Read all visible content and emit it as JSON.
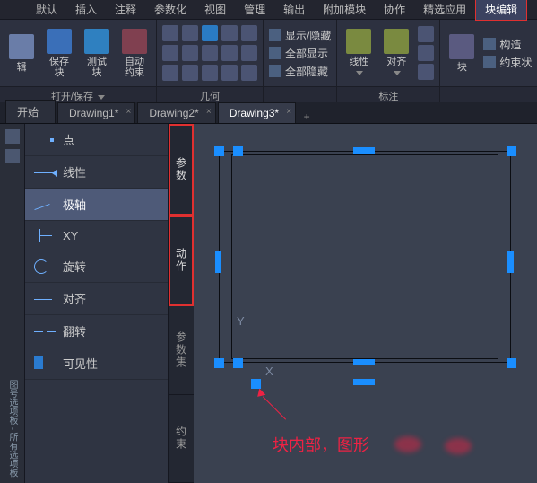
{
  "menu": {
    "items": [
      "默认",
      "插入",
      "注释",
      "参数化",
      "视图",
      "管理",
      "输出",
      "附加模块",
      "协作",
      "精选应用",
      "块编辑"
    ],
    "active_index": 10
  },
  "ribbon": {
    "panel_open": {
      "label": "打开/保存",
      "btn_edit": "辑",
      "btn_save": "保存\n块",
      "btn_test": "测试\n块",
      "btn_auto": "自动\n约束"
    },
    "panel_geom": {
      "label": "几何"
    },
    "panel_show": {
      "label": "",
      "btn_show": "显示/隐藏",
      "btn_all": "全部显示",
      "btn_hideall": "全部隐藏"
    },
    "panel_dim": {
      "label": "标注",
      "btn_linear": "线性",
      "btn_align": "对齐"
    },
    "panel_cons": {
      "label": "",
      "btn_block": "块",
      "btn_cons": "构造",
      "btn_status": "约束状"
    }
  },
  "tabs": [
    {
      "label": "开始",
      "active": false,
      "closable": false
    },
    {
      "label": "Drawing1*",
      "active": false,
      "closable": true
    },
    {
      "label": "Drawing2*",
      "active": false,
      "closable": true
    },
    {
      "label": "Drawing3*",
      "active": true,
      "closable": true
    }
  ],
  "gutter_label": "图号选项板 - 所有选项板",
  "palette": {
    "items": [
      {
        "label": "点",
        "icon": "point"
      },
      {
        "label": "线性",
        "icon": "linear"
      },
      {
        "label": "极轴",
        "icon": "polar",
        "selected": true
      },
      {
        "label": "XY",
        "icon": "xy"
      },
      {
        "label": "旋转",
        "icon": "rotate"
      },
      {
        "label": "对齐",
        "icon": "align"
      },
      {
        "label": "翻转",
        "icon": "flip"
      },
      {
        "label": "可见性",
        "icon": "vis"
      }
    ]
  },
  "sidetabs": {
    "items": [
      "参数",
      "动作",
      "参数集",
      "约束"
    ],
    "highlighted": [
      0,
      1
    ]
  },
  "canvas": {
    "axis_x": "X",
    "axis_y": "Y",
    "annotation": "块内部，图形"
  }
}
